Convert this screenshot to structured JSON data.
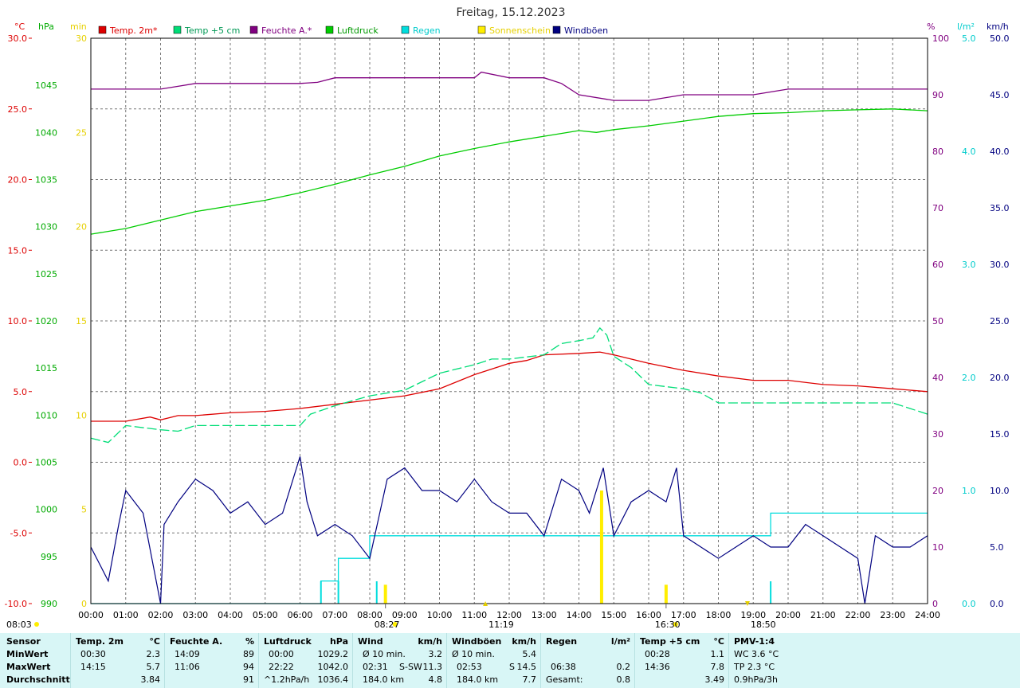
{
  "title": "Freitag, 15.12.2023",
  "colors": {
    "temp2m": "#dd0000",
    "temp5cm": "#00dd77",
    "humidity": "#800080",
    "pressure": "#00cc00",
    "rain": "#00dddd",
    "sunshine": "#ffee00",
    "gusts": "#000080"
  },
  "axes": {
    "temp_unit": "°C",
    "hpa_unit": "hPa",
    "min_unit": "min",
    "pct_unit": "%",
    "rain_unit": "l/m²",
    "kmh_unit": "km/h",
    "temp_ticks": [
      "30.0",
      "25.0",
      "20.0",
      "15.0",
      "10.0",
      "5.0",
      "0.0",
      "-5.0",
      "-10.0"
    ],
    "hpa_ticks": [
      "1045",
      "1040",
      "1035",
      "1030",
      "1025",
      "1020",
      "1015",
      "1010",
      "1005",
      "1000",
      "995",
      "990"
    ],
    "min_ticks": [
      "30",
      "25",
      "20",
      "15",
      "10",
      "5",
      "0"
    ],
    "pct_ticks": [
      "100",
      "90",
      "80",
      "70",
      "60",
      "50",
      "40",
      "30",
      "20",
      "10",
      "0"
    ],
    "rain_ticks": [
      "5.0",
      "4.0",
      "3.0",
      "2.0",
      "1.0",
      "0.0"
    ],
    "kmh_ticks": [
      "50.0",
      "45.0",
      "40.0",
      "35.0",
      "30.0",
      "25.0",
      "20.0",
      "15.0",
      "10.0",
      "5.0",
      "0.0"
    ],
    "time_ticks": [
      "00:00",
      "01:00",
      "02:00",
      "03:00",
      "04:00",
      "05:00",
      "06:00",
      "07:00",
      "08:00",
      "09:00",
      "10:00",
      "11:00",
      "12:00",
      "13:00",
      "14:00",
      "15:00",
      "16:00",
      "17:00",
      "18:00",
      "19:00",
      "20:00",
      "21:00",
      "22:00",
      "23:00",
      "24:00"
    ]
  },
  "legend": [
    {
      "label": "Temp. 2m*",
      "color": "#dd0000"
    },
    {
      "label": "Temp +5 cm",
      "color": "#00dd77"
    },
    {
      "label": "Feuchte A.*",
      "color": "#800080"
    },
    {
      "label": "Luftdruck",
      "color": "#00cc00"
    },
    {
      "label": "Regen",
      "color": "#00dddd"
    },
    {
      "label": "Sonnenschein",
      "color": "#ffee00"
    },
    {
      "label": "Windböen",
      "color": "#000080"
    }
  ],
  "markers": {
    "sunrise": "08:27",
    "noon": "11:19",
    "sunset": "16:30",
    "moon": "18:50",
    "left_time": "08:03"
  },
  "chart_data": {
    "type": "line",
    "title": "Freitag, 15.12.2023",
    "x_hours_range": [
      0,
      24
    ],
    "ylim_temp": [
      -10,
      30
    ],
    "ylim_pressure": [
      990,
      1050
    ],
    "ylim_sun_min": [
      0,
      30
    ],
    "ylim_humidity": [
      0,
      100
    ],
    "ylim_rain": [
      0,
      5
    ],
    "ylim_gusts": [
      0,
      50
    ],
    "grid": true,
    "series": [
      {
        "name": "Temp. 2m*",
        "axis": "temp",
        "x": [
          0,
          1,
          1.7,
          2,
          2.5,
          3,
          4,
          5,
          6,
          7,
          8,
          9,
          10,
          11,
          12,
          12.5,
          13,
          14,
          14.6,
          15,
          16,
          17,
          18,
          19,
          20,
          21,
          22,
          23,
          24
        ],
        "y": [
          2.9,
          2.9,
          3.2,
          3.0,
          3.3,
          3.3,
          3.5,
          3.6,
          3.8,
          4.1,
          4.4,
          4.7,
          5.2,
          6.2,
          7.0,
          7.2,
          7.6,
          7.7,
          7.8,
          7.6,
          7.0,
          6.5,
          6.1,
          5.8,
          5.8,
          5.5,
          5.4,
          5.2,
          5.0
        ]
      },
      {
        "name": "Temp +5 cm",
        "axis": "temp",
        "x": [
          0,
          0.5,
          1,
          2,
          2.5,
          3,
          4,
          5,
          6,
          6.3,
          7,
          8,
          9,
          10,
          11,
          11.5,
          12,
          13,
          13.5,
          14,
          14.4,
          14.6,
          14.8,
          15,
          15.5,
          16,
          17,
          17.5,
          18,
          19,
          20,
          21,
          22,
          23,
          23.5,
          24
        ],
        "y": [
          1.7,
          1.4,
          2.6,
          2.3,
          2.2,
          2.6,
          2.6,
          2.6,
          2.6,
          3.4,
          4.0,
          4.7,
          5.1,
          6.3,
          6.9,
          7.3,
          7.3,
          7.6,
          8.4,
          8.6,
          8.8,
          9.5,
          9.0,
          7.5,
          6.7,
          5.5,
          5.2,
          4.9,
          4.2,
          4.2,
          4.2,
          4.2,
          4.2,
          4.2,
          3.8,
          3.4
        ]
      },
      {
        "name": "Feuchte A.*",
        "axis": "humidity",
        "x": [
          0,
          1,
          2,
          2.5,
          3,
          4,
          5,
          6,
          6.5,
          7,
          8,
          9,
          10,
          11,
          11.2,
          12,
          13,
          13.5,
          14,
          15,
          16,
          17,
          18,
          19,
          20,
          21,
          22,
          23,
          24
        ],
        "y": [
          91,
          91,
          91,
          91.5,
          92,
          92,
          92,
          92,
          92.2,
          93,
          93,
          93,
          93,
          93,
          94,
          93,
          93,
          92,
          90,
          89,
          89,
          90,
          90,
          90,
          91,
          91,
          91,
          91,
          91
        ]
      },
      {
        "name": "Luftdruck",
        "axis": "pressure",
        "x": [
          0,
          1,
          2,
          3,
          4,
          5,
          6,
          7,
          8,
          9,
          10,
          11,
          12,
          13,
          14,
          14.5,
          15,
          16,
          17,
          18,
          19,
          20,
          21,
          22,
          23,
          24
        ],
        "y": [
          1029.2,
          1029.8,
          1030.7,
          1031.6,
          1032.2,
          1032.8,
          1033.6,
          1034.5,
          1035.5,
          1036.4,
          1037.5,
          1038.3,
          1039.0,
          1039.6,
          1040.2,
          1040.0,
          1040.3,
          1040.7,
          1041.2,
          1041.7,
          1042.0,
          1042.1,
          1042.3,
          1042.4,
          1042.5,
          1042.3
        ]
      },
      {
        "name": "Regen",
        "axis": "rain",
        "x": [
          0,
          6.6,
          6.6,
          7.1,
          7.1,
          8.0,
          8.0,
          8.2,
          8.2,
          19.5,
          19.5,
          24
        ],
        "y": [
          0,
          0,
          0.2,
          0.2,
          0.4,
          0.4,
          0.6,
          0.6,
          0.6,
          0.6,
          0.8,
          0.8
        ]
      },
      {
        "name": "Sonnenschein",
        "axis": "sun_min",
        "x": [
          8.45,
          14.65,
          16.5
        ],
        "y": [
          1.0,
          6.0,
          1.0
        ]
      },
      {
        "name": "Windböen",
        "axis": "gusts",
        "x": [
          0,
          0.5,
          0.8,
          1,
          1.5,
          2,
          2.1,
          2.5,
          3,
          3.5,
          4,
          4.5,
          5,
          5.5,
          6,
          6.2,
          6.5,
          7,
          7.5,
          8,
          8.5,
          9,
          9.5,
          10,
          10.5,
          11,
          11.5,
          12,
          12.5,
          13,
          13.5,
          14,
          14.3,
          14.7,
          15,
          15.5,
          16,
          16.5,
          16.8,
          17,
          17.5,
          18,
          18.5,
          19,
          19.5,
          20,
          20.5,
          21,
          21.5,
          22,
          22.2,
          22.5,
          23,
          23.5,
          24
        ],
        "y": [
          5.0,
          2.0,
          7.0,
          10.0,
          8.0,
          0.0,
          7.0,
          9.0,
          11.0,
          10.0,
          8.0,
          9.0,
          7.0,
          8.0,
          13.0,
          9.0,
          6.0,
          7.0,
          6.0,
          4.0,
          11.0,
          12.0,
          10.0,
          10.0,
          9.0,
          11.0,
          9.0,
          8.0,
          8.0,
          6.0,
          11.0,
          10.0,
          8.0,
          12.0,
          6.0,
          9.0,
          10.0,
          9.0,
          12.0,
          6.0,
          5.0,
          4.0,
          5.0,
          6.0,
          5.0,
          5.0,
          7.0,
          6.0,
          5.0,
          4.0,
          0.0,
          6.0,
          5.0,
          5.0,
          6.0
        ]
      }
    ]
  },
  "summary": {
    "rows": [
      "Sensor",
      "MinWert",
      "MaxWert",
      "Durchschnitt"
    ],
    "temp2m": {
      "title": "Temp. 2m",
      "unit": "°C",
      "min_time": "00:30",
      "min_val": "2.3",
      "max_time": "14:15",
      "max_val": "5.7",
      "avg": "3.84"
    },
    "humidity": {
      "title": "Feuchte A.",
      "unit": "%",
      "min_time": "14:09",
      "min_val": "89",
      "max_time": "11:06",
      "max_val": "94",
      "avg": "91"
    },
    "pressure": {
      "title": "Luftdruck",
      "unit": "hPa",
      "min_time": "00:00",
      "min_val": "1029.2",
      "max_time": "22:22",
      "max_val": "1042.0",
      "trend": "^1.2hPa/h",
      "avg": "1036.4"
    },
    "wind": {
      "title": "Wind",
      "unit": "km/h",
      "min_label": "Ø 10 min.",
      "min_val": "3.2",
      "max_time": "02:31",
      "max_dir": "S-SW",
      "max_val": "11.3",
      "dist": "184.0 km",
      "avg": "4.8"
    },
    "gusts": {
      "title": "Windböen",
      "unit": "km/h",
      "min_label": "Ø 10 min.",
      "min_val": "5.4",
      "max_time": "02:53",
      "max_dir": "S",
      "max_val": "14.5",
      "dist": "184.0 km",
      "avg": "7.7"
    },
    "rain": {
      "title": "Regen",
      "unit": "l/m²",
      "max_time": "06:38",
      "max_val": "0.2",
      "total_label": "Gesamt:",
      "total": "0.8"
    },
    "temp5cm": {
      "title": "Temp +5 cm",
      "unit": "°C",
      "min_time": "00:28",
      "min_val": "1.1",
      "max_time": "14:36",
      "max_val": "7.8",
      "avg": "3.49"
    },
    "pmv": {
      "title": "PMV-1:4",
      "wc": "WC 3.6 °C",
      "tp": "TP 2.3 °C",
      "trend": "0.9hPa/3h"
    }
  }
}
